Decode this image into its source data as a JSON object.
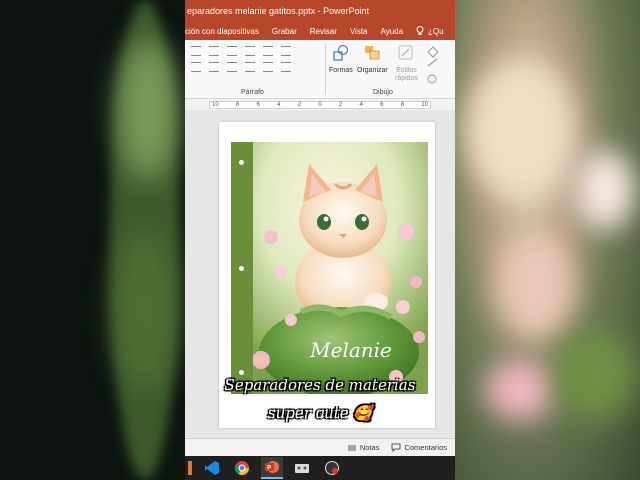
{
  "window": {
    "title": "eparadores melanie gatitos.pptx  -  PowerPoint"
  },
  "menu": {
    "items": [
      "ción con diapositivas",
      "Grabar",
      "Revisar",
      "Vista",
      "Ayuda"
    ],
    "tell_me": "¿Qu"
  },
  "ribbon": {
    "group_paragraph": "Párrafo",
    "group_drawing": "Dibujo",
    "shapes_label": "Formas",
    "arrange_label": "Organizar",
    "quick_styles_line1": "Estilos",
    "quick_styles_line2": "rápidos"
  },
  "ruler": {
    "ticks": [
      "10",
      "8",
      "6",
      "4",
      "2",
      "0",
      "2",
      "4",
      "6",
      "8",
      "10"
    ]
  },
  "slide": {
    "name_text": "Melanie"
  },
  "status": {
    "notes_label": "Notas",
    "comments_label": "Comentarios"
  },
  "caption": {
    "line1": "Separadores de materias",
    "line2": "super cute 🥰"
  },
  "colors": {
    "brand": "#b7472a",
    "spine_green": "#6b8e3a"
  }
}
